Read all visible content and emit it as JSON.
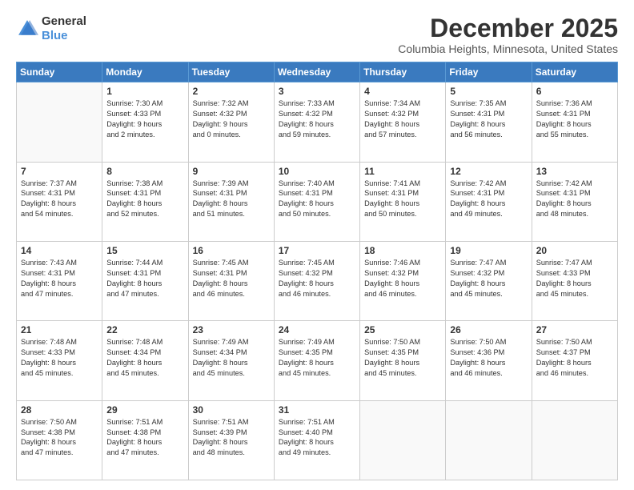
{
  "logo": {
    "general": "General",
    "blue": "Blue"
  },
  "header": {
    "month": "December 2025",
    "location": "Columbia Heights, Minnesota, United States"
  },
  "days_of_week": [
    "Sunday",
    "Monday",
    "Tuesday",
    "Wednesday",
    "Thursday",
    "Friday",
    "Saturday"
  ],
  "weeks": [
    [
      {
        "day": "",
        "content": ""
      },
      {
        "day": "1",
        "content": "Sunrise: 7:30 AM\nSunset: 4:33 PM\nDaylight: 9 hours\nand 2 minutes."
      },
      {
        "day": "2",
        "content": "Sunrise: 7:32 AM\nSunset: 4:32 PM\nDaylight: 9 hours\nand 0 minutes."
      },
      {
        "day": "3",
        "content": "Sunrise: 7:33 AM\nSunset: 4:32 PM\nDaylight: 8 hours\nand 59 minutes."
      },
      {
        "day": "4",
        "content": "Sunrise: 7:34 AM\nSunset: 4:32 PM\nDaylight: 8 hours\nand 57 minutes."
      },
      {
        "day": "5",
        "content": "Sunrise: 7:35 AM\nSunset: 4:31 PM\nDaylight: 8 hours\nand 56 minutes."
      },
      {
        "day": "6",
        "content": "Sunrise: 7:36 AM\nSunset: 4:31 PM\nDaylight: 8 hours\nand 55 minutes."
      }
    ],
    [
      {
        "day": "7",
        "content": "Sunrise: 7:37 AM\nSunset: 4:31 PM\nDaylight: 8 hours\nand 54 minutes."
      },
      {
        "day": "8",
        "content": "Sunrise: 7:38 AM\nSunset: 4:31 PM\nDaylight: 8 hours\nand 52 minutes."
      },
      {
        "day": "9",
        "content": "Sunrise: 7:39 AM\nSunset: 4:31 PM\nDaylight: 8 hours\nand 51 minutes."
      },
      {
        "day": "10",
        "content": "Sunrise: 7:40 AM\nSunset: 4:31 PM\nDaylight: 8 hours\nand 50 minutes."
      },
      {
        "day": "11",
        "content": "Sunrise: 7:41 AM\nSunset: 4:31 PM\nDaylight: 8 hours\nand 50 minutes."
      },
      {
        "day": "12",
        "content": "Sunrise: 7:42 AM\nSunset: 4:31 PM\nDaylight: 8 hours\nand 49 minutes."
      },
      {
        "day": "13",
        "content": "Sunrise: 7:42 AM\nSunset: 4:31 PM\nDaylight: 8 hours\nand 48 minutes."
      }
    ],
    [
      {
        "day": "14",
        "content": "Sunrise: 7:43 AM\nSunset: 4:31 PM\nDaylight: 8 hours\nand 47 minutes."
      },
      {
        "day": "15",
        "content": "Sunrise: 7:44 AM\nSunset: 4:31 PM\nDaylight: 8 hours\nand 47 minutes."
      },
      {
        "day": "16",
        "content": "Sunrise: 7:45 AM\nSunset: 4:31 PM\nDaylight: 8 hours\nand 46 minutes."
      },
      {
        "day": "17",
        "content": "Sunrise: 7:45 AM\nSunset: 4:32 PM\nDaylight: 8 hours\nand 46 minutes."
      },
      {
        "day": "18",
        "content": "Sunrise: 7:46 AM\nSunset: 4:32 PM\nDaylight: 8 hours\nand 46 minutes."
      },
      {
        "day": "19",
        "content": "Sunrise: 7:47 AM\nSunset: 4:32 PM\nDaylight: 8 hours\nand 45 minutes."
      },
      {
        "day": "20",
        "content": "Sunrise: 7:47 AM\nSunset: 4:33 PM\nDaylight: 8 hours\nand 45 minutes."
      }
    ],
    [
      {
        "day": "21",
        "content": "Sunrise: 7:48 AM\nSunset: 4:33 PM\nDaylight: 8 hours\nand 45 minutes."
      },
      {
        "day": "22",
        "content": "Sunrise: 7:48 AM\nSunset: 4:34 PM\nDaylight: 8 hours\nand 45 minutes."
      },
      {
        "day": "23",
        "content": "Sunrise: 7:49 AM\nSunset: 4:34 PM\nDaylight: 8 hours\nand 45 minutes."
      },
      {
        "day": "24",
        "content": "Sunrise: 7:49 AM\nSunset: 4:35 PM\nDaylight: 8 hours\nand 45 minutes."
      },
      {
        "day": "25",
        "content": "Sunrise: 7:50 AM\nSunset: 4:35 PM\nDaylight: 8 hours\nand 45 minutes."
      },
      {
        "day": "26",
        "content": "Sunrise: 7:50 AM\nSunset: 4:36 PM\nDaylight: 8 hours\nand 46 minutes."
      },
      {
        "day": "27",
        "content": "Sunrise: 7:50 AM\nSunset: 4:37 PM\nDaylight: 8 hours\nand 46 minutes."
      }
    ],
    [
      {
        "day": "28",
        "content": "Sunrise: 7:50 AM\nSunset: 4:38 PM\nDaylight: 8 hours\nand 47 minutes."
      },
      {
        "day": "29",
        "content": "Sunrise: 7:51 AM\nSunset: 4:38 PM\nDaylight: 8 hours\nand 47 minutes."
      },
      {
        "day": "30",
        "content": "Sunrise: 7:51 AM\nSunset: 4:39 PM\nDaylight: 8 hours\nand 48 minutes."
      },
      {
        "day": "31",
        "content": "Sunrise: 7:51 AM\nSunset: 4:40 PM\nDaylight: 8 hours\nand 49 minutes."
      },
      {
        "day": "",
        "content": ""
      },
      {
        "day": "",
        "content": ""
      },
      {
        "day": "",
        "content": ""
      }
    ]
  ]
}
